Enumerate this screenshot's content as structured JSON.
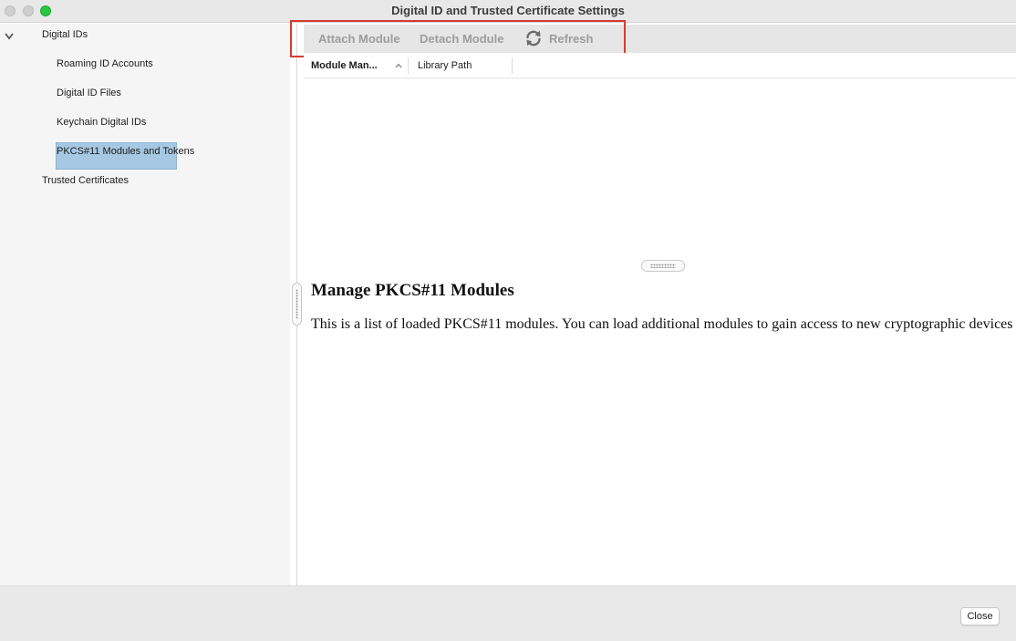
{
  "window": {
    "title": "Digital ID and Trusted Certificate Settings"
  },
  "sidebar": {
    "items": [
      {
        "label": "Digital IDs",
        "expanded": true
      },
      {
        "label": "Roaming ID Accounts"
      },
      {
        "label": "Digital ID Files"
      },
      {
        "label": "Keychain Digital IDs"
      },
      {
        "label": "PKCS#11 Modules and Tokens",
        "selected": true
      },
      {
        "label": "Trusted Certificates"
      }
    ]
  },
  "toolbar": {
    "attach_label": "Attach Module",
    "detach_label": "Detach Module",
    "refresh_label": "Refresh",
    "refresh_icon": "refresh-icon"
  },
  "table": {
    "columns": [
      "Module Man...",
      "Library Path"
    ],
    "sort_column": "Module Man...",
    "sort_direction": "ascending",
    "rows": []
  },
  "description": {
    "title": "Manage PKCS#11 Modules",
    "body": "This is a list of loaded PKCS#11 modules. You can load additional modules to gain access to new cryptographic devices"
  },
  "footer": {
    "close_label": "Close"
  },
  "colors": {
    "highlight": "#d63b2f",
    "selection": "#a6c8e2",
    "maximize": "#29c740"
  }
}
